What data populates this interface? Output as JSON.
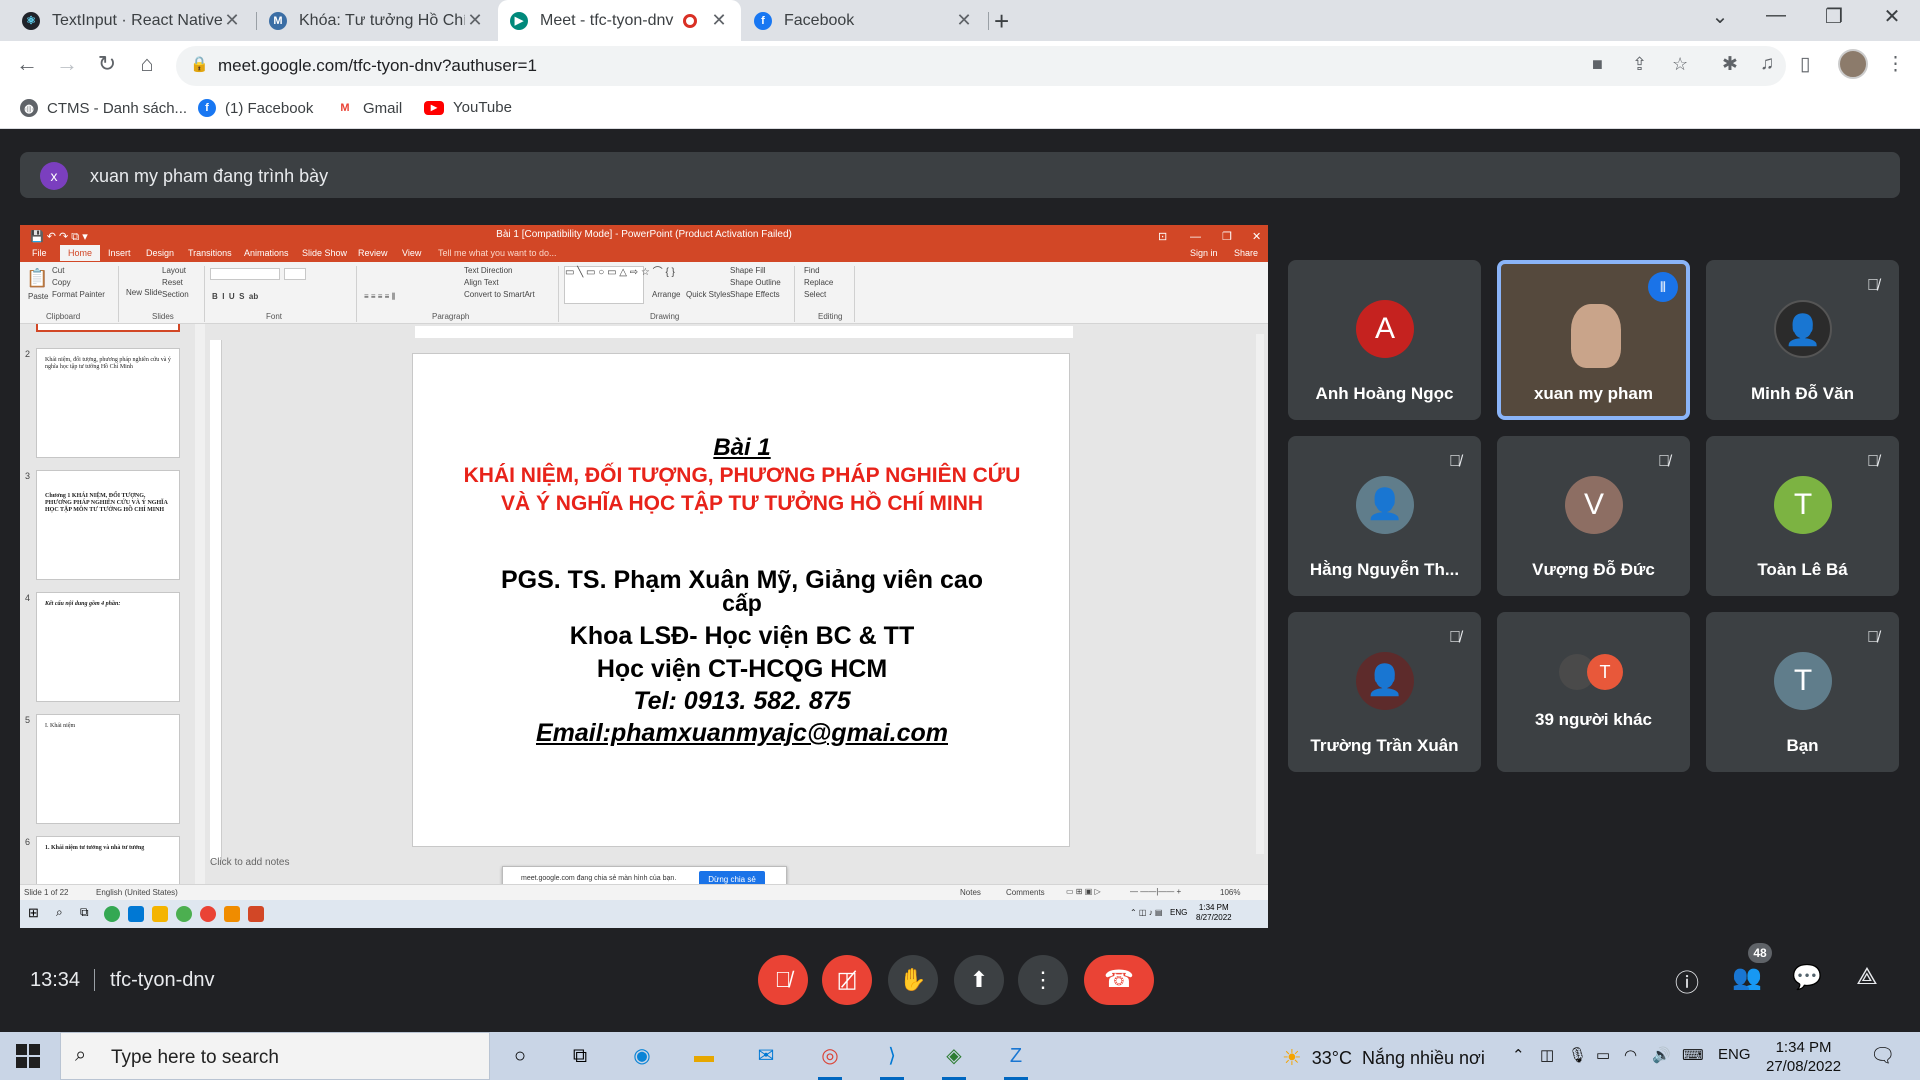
{
  "browser": {
    "tabs": [
      {
        "title": "TextInput · React Native"
      },
      {
        "title": "Khóa: Tư tưởng Hồ Chí Minh - ch"
      },
      {
        "title": "Meet - tfc-tyon-dnv"
      },
      {
        "title": "Facebook"
      }
    ],
    "url": "meet.google.com/tfc-tyon-dnv?authuser=1",
    "bookmarks": [
      {
        "label": "CTMS - Danh sách..."
      },
      {
        "label": "(1) Facebook"
      },
      {
        "label": "Gmail"
      },
      {
        "label": "YouTube"
      }
    ]
  },
  "meet": {
    "presenting_banner": "xuan my pham đang trình bày",
    "presenter_initial": "x",
    "clock": "13:34",
    "meeting_code": "tfc-tyon-dnv",
    "people_count": "48",
    "participants": [
      {
        "name": "Anh Hoàng Ngọc",
        "initial": "A",
        "color": "#c5221f"
      },
      {
        "name": "xuan my pham",
        "speaking": true
      },
      {
        "name": "Minh Đỗ Văn"
      },
      {
        "name": "Hằng Nguyễn Th..."
      },
      {
        "name": "Vượng Đỗ Đức",
        "initial": "V",
        "color": "#8d6e63"
      },
      {
        "name": "Toàn Lê Bá",
        "initial": "T",
        "color": "#7cb342"
      },
      {
        "name": "Trường Trần Xuân"
      },
      {
        "name": "39 người khác",
        "initial": "T",
        "color": "#e8583a"
      },
      {
        "name": "Bạn",
        "initial": "T",
        "color": "#607d8b"
      }
    ]
  },
  "powerpoint": {
    "title": "Bài 1 [Compatibility Mode] - PowerPoint (Product Activation Failed)",
    "tabs": [
      "File",
      "Home",
      "Insert",
      "Design",
      "Transitions",
      "Animations",
      "Slide Show",
      "Review",
      "View"
    ],
    "tell_me": "Tell me what you want to do...",
    "sign_in": "Sign in",
    "share": "Share",
    "groups": [
      "Clipboard",
      "Slides",
      "Font",
      "Paragraph",
      "Drawing",
      "Editing"
    ],
    "clipboard": {
      "paste": "Paste",
      "cut": "Cut",
      "copy": "Copy",
      "format": "Format Painter"
    },
    "slides_grp": {
      "new": "New Slide",
      "layout": "Layout",
      "reset": "Reset",
      "section": "Section"
    },
    "drawing": {
      "arrange": "Arrange",
      "quick": "Quick Styles",
      "fill": "Shape Fill",
      "outline": "Shape Outline",
      "effects": "Shape Effects"
    },
    "editing": {
      "find": "Find",
      "replace": "Replace",
      "select": "Select"
    },
    "paragraph": {
      "dir": "Text Direction",
      "align": "Align Text",
      "smart": "Convert to SmartArt"
    },
    "thumbs": [
      {
        "num": "2",
        "text": "Khái niệm, đối tượng, phương pháp nghiên cứu và ý nghĩa học tập tư tưởng Hồ Chí Minh"
      },
      {
        "num": "3",
        "text": "Chương 1 KHÁI NIỆM, ĐỐI TƯỢNG, PHƯƠNG PHÁP NGHIÊN CỨU VÀ Ý NGHĨA HỌC TẬP MÔN TƯ TƯỞNG HỒ CHÍ MINH"
      },
      {
        "num": "4",
        "text": "Kết cấu nội dung gồm 4 phần:"
      },
      {
        "num": "5",
        "text": "I. Khái niệm"
      },
      {
        "num": "6",
        "text": "1. Khái niệm tư tưởng và nhà tư tưởng"
      }
    ],
    "slide": {
      "title": "Bài 1",
      "red_line1": "KHÁI NIỆM, ĐỐI TƯỢNG, PHƯƠNG PHÁP NGHIÊN CỨU",
      "red_line2": "VÀ Ý NGHĨA HỌC TẬP TƯ TƯỞNG HỒ CHÍ MINH",
      "author1": "PGS. TS. Phạm Xuân Mỹ, Giảng viên cao",
      "author2": "cấp",
      "faculty": "Khoa LSĐ- Học viện BC & TT",
      "academy": "Học viện CT-HCQG HCM",
      "tel": "Tel: 0913. 582. 875",
      "email": "Email:phamxuanmyajc@gmai.com"
    },
    "notes_placeholder": "Click to add notes",
    "share_notice": "meet.google.com đang chia sẻ màn hình của bạn.",
    "share_stop": "Dừng chia sẻ",
    "status_slide": "Slide 1 of 22",
    "status_lang": "English (United States)",
    "status_notes": "Notes",
    "status_comments": "Comments",
    "zoom": "106%",
    "inner_time": "1:34 PM",
    "inner_date": "8/27/2022",
    "inner_lang": "ENG"
  },
  "taskbar": {
    "search_placeholder": "Type here to search",
    "weather_temp": "33°C",
    "weather_text": "Nắng nhiều nơi",
    "lang": "ENG",
    "time": "1:34 PM",
    "date": "27/08/2022"
  }
}
